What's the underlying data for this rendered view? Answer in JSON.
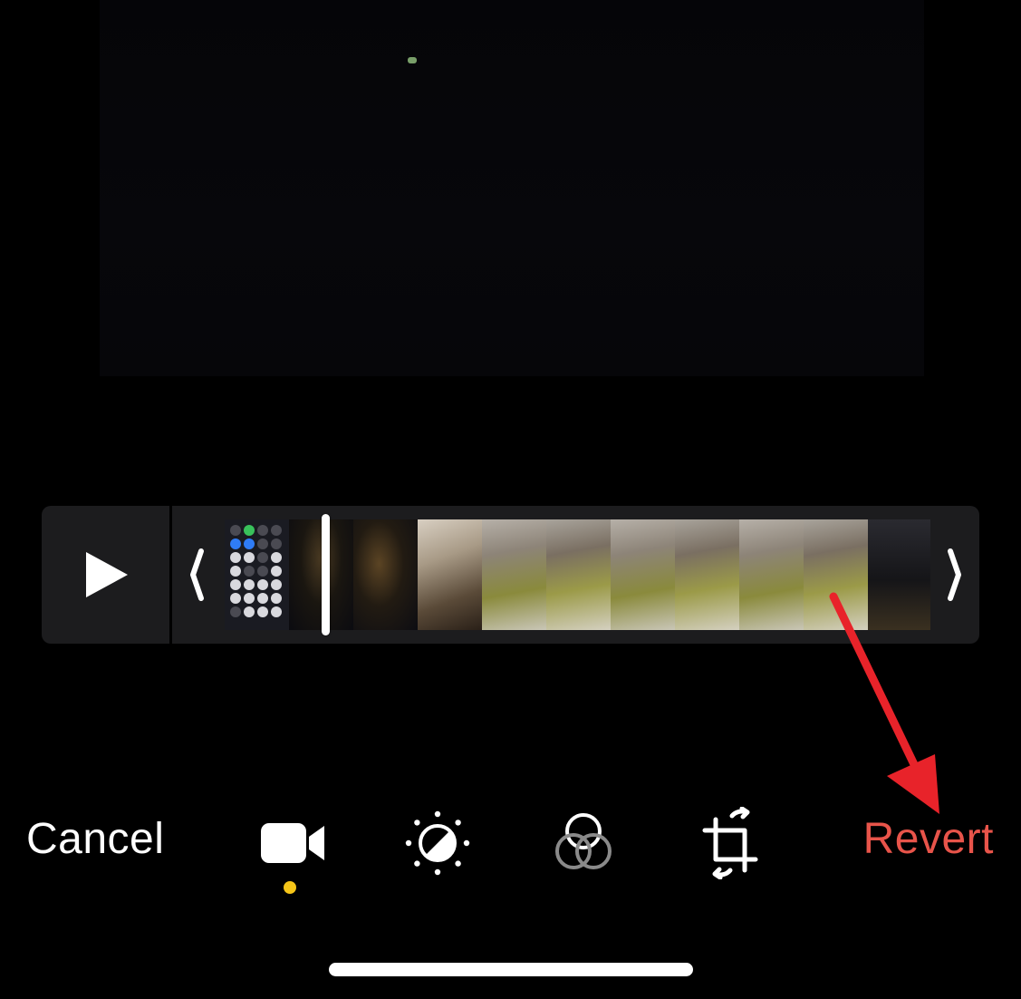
{
  "toolbar": {
    "cancel_label": "Cancel",
    "revert_label": "Revert",
    "tools": [
      {
        "name": "video-icon",
        "active": true
      },
      {
        "name": "adjust-icon",
        "active": false
      },
      {
        "name": "filters-icon",
        "active": false
      },
      {
        "name": "crop-rotate-icon",
        "active": false
      }
    ],
    "active_indicator_color": "#f5c518"
  },
  "timeline": {
    "play_icon": "play-icon",
    "trim_left_icon": "trim-left-handle-icon",
    "trim_right_icon": "trim-right-handle-icon"
  },
  "colors": {
    "background": "#000000",
    "timeline_background": "#1c1c1e",
    "revert": "#e8544a",
    "annotation_arrow": "#e8232a"
  }
}
